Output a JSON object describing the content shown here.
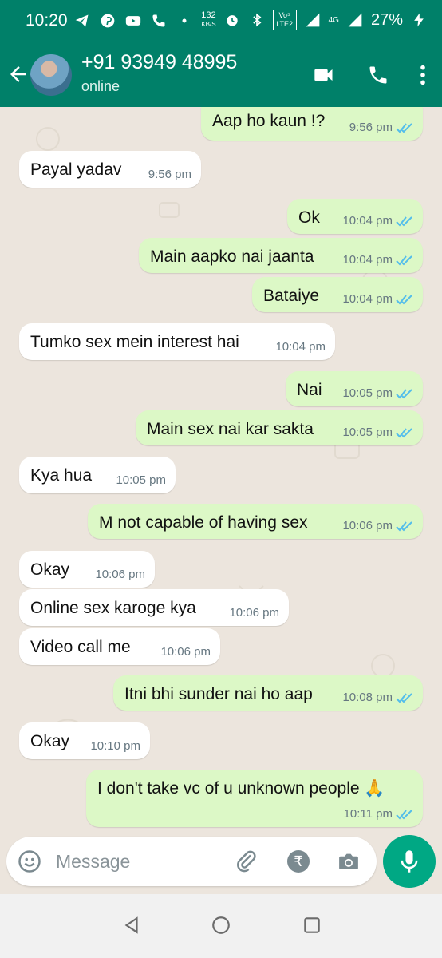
{
  "status_bar": {
    "time": "10:20",
    "net_speed_value": "132",
    "net_speed_unit": "KB/S",
    "volte": "Vo⁵ LTE2",
    "network": "4G",
    "battery": "27%"
  },
  "header": {
    "contact_name": "+91 93949 48995",
    "contact_status": "online"
  },
  "messages": [
    {
      "dir": "out",
      "text": "Aap ho kaun !?",
      "time": "9:56 pm"
    },
    {
      "dir": "in",
      "text": "Payal yadav",
      "time": "9:56 pm"
    },
    {
      "dir": "out",
      "text": "Ok",
      "time": "10:04 pm"
    },
    {
      "dir": "out",
      "text": "Main aapko nai jaanta",
      "time": "10:04 pm"
    },
    {
      "dir": "out",
      "text": "Bataiye",
      "time": "10:04 pm"
    },
    {
      "dir": "in",
      "text": "Tumko sex mein interest hai",
      "time": "10:04 pm"
    },
    {
      "dir": "out",
      "text": "Nai",
      "time": "10:05 pm"
    },
    {
      "dir": "out",
      "text": "Main sex nai kar sakta",
      "time": "10:05 pm"
    },
    {
      "dir": "in",
      "text": "Kya hua",
      "time": "10:05 pm"
    },
    {
      "dir": "out",
      "text": "M not capable of having sex",
      "time": "10:06 pm"
    },
    {
      "dir": "in",
      "text": "Okay",
      "time": "10:06 pm"
    },
    {
      "dir": "in",
      "text": "Online sex karoge kya",
      "time": "10:06 pm"
    },
    {
      "dir": "in",
      "text": "Video call me",
      "time": "10:06 pm"
    },
    {
      "dir": "out",
      "text": "Itni bhi sunder nai ho aap",
      "time": "10:08 pm"
    },
    {
      "dir": "in",
      "text": "Okay",
      "time": "10:10 pm"
    },
    {
      "dir": "out",
      "text": "I don't take vc of u unknown people 🙏",
      "time": "10:11 pm"
    }
  ],
  "composer": {
    "placeholder": "Message",
    "rupee_symbol": "₹"
  },
  "colors": {
    "header": "#008069",
    "outgoing_bubble": "#dcf8c6",
    "incoming_bubble": "#ffffff",
    "read_ticks": "#53bdeb",
    "mic_button": "#00a884"
  },
  "icons": [
    "telegram-icon",
    "pinterest-icon",
    "youtube-icon",
    "wifi-call-icon",
    "alarm-icon",
    "bluetooth-icon",
    "signal-icon",
    "battery-charging-icon",
    "back-arrow-icon",
    "video-call-icon",
    "phone-icon",
    "more-vert-icon",
    "emoji-icon",
    "attach-icon",
    "rupee-icon",
    "camera-icon",
    "mic-icon",
    "nav-back-icon",
    "nav-home-icon",
    "nav-recents-icon"
  ]
}
